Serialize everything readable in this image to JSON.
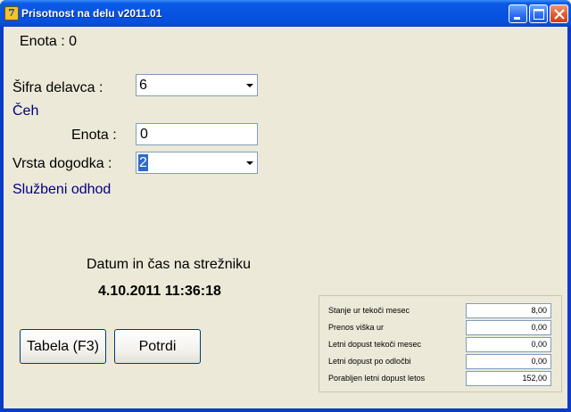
{
  "window": {
    "title": "Prisotnost na delu v2011.01",
    "app_icon_glyph": "7"
  },
  "header": {
    "enota_display": "Enota : 0"
  },
  "form": {
    "sifra_label": "Šifra delavca   :",
    "sifra_value": "6",
    "worker_name": "Čeh",
    "enota_label": "Enota :",
    "enota_value": "0",
    "vrsta_label": "Vrsta dogodka :",
    "vrsta_value": "2",
    "event_name": "Službeni odhod"
  },
  "server": {
    "caption": "Datum in čas na strežniku",
    "datetime": "4.10.2011 11:36:18"
  },
  "buttons": {
    "tabela": "Tabela (F3)",
    "potrdi": "Potrdi"
  },
  "stats": [
    {
      "label": "Stanje ur tekoči mesec",
      "value": "8,00"
    },
    {
      "label": "Prenos viška ur",
      "value": "0,00"
    },
    {
      "label": "Letni dopust tekoči mesec",
      "value": "0,00"
    },
    {
      "label": "Letni dopust po odločbi",
      "value": "0,00"
    },
    {
      "label": "Porabljen letni dopust letos",
      "value": "152,00"
    }
  ],
  "colors": {
    "titlebar": "#0754e0",
    "label_blue": "#000080",
    "selection": "#316ac5"
  }
}
